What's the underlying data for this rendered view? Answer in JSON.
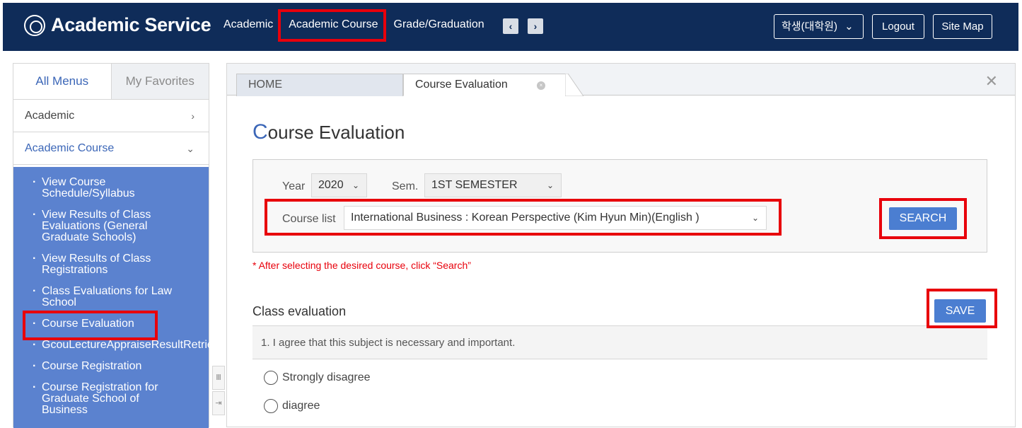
{
  "app": {
    "title": "Academic Service"
  },
  "topnav": {
    "items": [
      "Academic",
      "Academic Course",
      "Grade/Graduation"
    ],
    "prev_icon": "‹",
    "next_icon": "›",
    "user_role": "학생(대학원)",
    "user_role_chevron": "⌄",
    "logout_label": "Logout",
    "sitemap_label": "Site Map"
  },
  "sidebar": {
    "tabs": [
      "All Menus",
      "My Favorites"
    ],
    "sections": [
      {
        "label": "Academic",
        "chevron": "›"
      },
      {
        "label": "Academic Course",
        "chevron": "⌄"
      }
    ],
    "submenu": [
      "View Course Schedule/Syllabus",
      "View Results of Class Evaluations (General Graduate Schools)",
      "View Results of Class Registrations",
      "Class Evaluations for Law School",
      "Course Evaluation",
      "GcouLectureAppraiseResultRetrieveInq",
      "Course Registration",
      "Course Registration for Graduate School of Business"
    ],
    "handle_icons": [
      "Ⅲ",
      "⇥"
    ]
  },
  "tabs": {
    "home": "HOME",
    "current": "Course Evaluation",
    "tab_close_icon": "×",
    "panel_close_icon": "✕"
  },
  "page": {
    "title_cap": "C",
    "title_rest": "ourse Evaluation"
  },
  "search": {
    "year_label": "Year",
    "year_value": "2020",
    "sem_label": "Sem.",
    "sem_value": "1ST SEMESTER",
    "course_label": "Course list",
    "course_value": "International Business : Korean Perspective (Kim Hyun Min)(English )",
    "dropdown_icon": "⌄",
    "search_button": "SEARCH",
    "note": "* After selecting the desired course, click “Search”"
  },
  "evaluation": {
    "section_title": "Class evaluation",
    "save_button": "SAVE",
    "question": "1. I agree that this subject is necessary and important.",
    "options": [
      "Strongly disagree",
      "diagree"
    ]
  },
  "colors": {
    "topbar": "#0f2c59",
    "sidebar_submenu": "#5b82cf",
    "accent_blue": "#4b7ed1",
    "highlight_red": "#e8000b"
  }
}
